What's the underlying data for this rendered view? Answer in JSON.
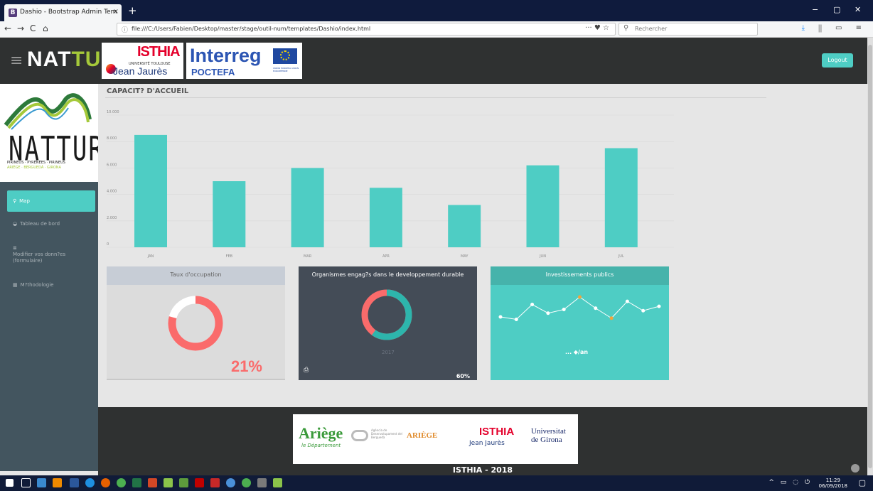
{
  "browser": {
    "tab_title": "Dashio - Bootstrap Admin Tem",
    "tab_close": "×",
    "new_tab": "+",
    "url": "file:///C:/Users/Fabien/Desktop/master/stage/outil-num/templates/Dashio/index.html",
    "search_placeholder": "Rechercher",
    "url_actions": "··· ♥ ☆",
    "back": "←",
    "forward": "→",
    "reload": "C",
    "home": "⌂",
    "minimize": "−",
    "maximize": "▢",
    "close": "✕"
  },
  "header": {
    "brand_main": "NAT",
    "brand_accent": "TUR",
    "logout_label": "Logout",
    "isthia_logo": "ISTHIA",
    "isthia_university": "UNIVERSITÉ TOULOUSE",
    "isthia_jj": "Jean Jaurès",
    "interreg": "Interreg",
    "poctefa": "POCTEFA",
    "eu_caption": "UNIÓN EUROPEA UNION EUROPÉENNE"
  },
  "sidebar": {
    "logo_word": "NATTUR",
    "logo_sub1": "PIRINEOS · PYRÉNÉES · PIRINEUS",
    "logo_sub2": "ARIÈGE · BERGUEDÀ · GIRONA",
    "items": [
      {
        "label": "Map",
        "icon": "map-marker-icon",
        "active": true
      },
      {
        "label": "Tableau de bord",
        "icon": "dashboard-icon",
        "active": false
      },
      {
        "label": "Modifier vos donn?es (formulaire)",
        "icon": "list-icon",
        "active": false
      },
      {
        "label": "M?thodologie",
        "icon": "grid-icon",
        "active": false
      }
    ]
  },
  "main": {
    "section_title": "CAPACIT? D'ACCUEIL"
  },
  "chart_data": {
    "type": "bar",
    "categories": [
      "JAN",
      "FEB",
      "MAR",
      "APR",
      "MAY",
      "JUN",
      "JUL"
    ],
    "values": [
      8500,
      5000,
      6000,
      4500,
      3200,
      6200,
      7500
    ],
    "yticks": [
      "0",
      "2.000",
      "4.000",
      "6.000",
      "8.000",
      "10.000"
    ],
    "ylim": [
      0,
      10000
    ],
    "bar_color": "#4ecdc4",
    "grid": true
  },
  "panels": {
    "occupation": {
      "title": "Taux d'occupation",
      "value": "21%",
      "fraction": 0.21
    },
    "organismes": {
      "title": "Organismes engag?s dans le developpement durable",
      "year": "2017",
      "value": "60%",
      "fraction": 0.6
    },
    "investissements": {
      "title": "Investissements publics",
      "label": "... ◆/an",
      "spark": [
        40,
        36,
        60,
        46,
        52,
        72,
        54,
        38,
        65,
        50,
        57
      ]
    }
  },
  "footer": {
    "ariege": "Ariège",
    "ariege_sub": "le Département",
    "agency": "Agència de Desenvolupament del Berguedà",
    "ariege2": "ARIÈGE",
    "isthia": "ISTHIA",
    "isthia_jj": "Jean Jaurès",
    "girona1": "Universitat",
    "girona2": "de Girona",
    "caption": "ISTHIA - 2018"
  },
  "taskbar": {
    "time": "11:29",
    "date": "06/09/2018",
    "tray_icons": "^ ▭ ◌ ⏻"
  }
}
